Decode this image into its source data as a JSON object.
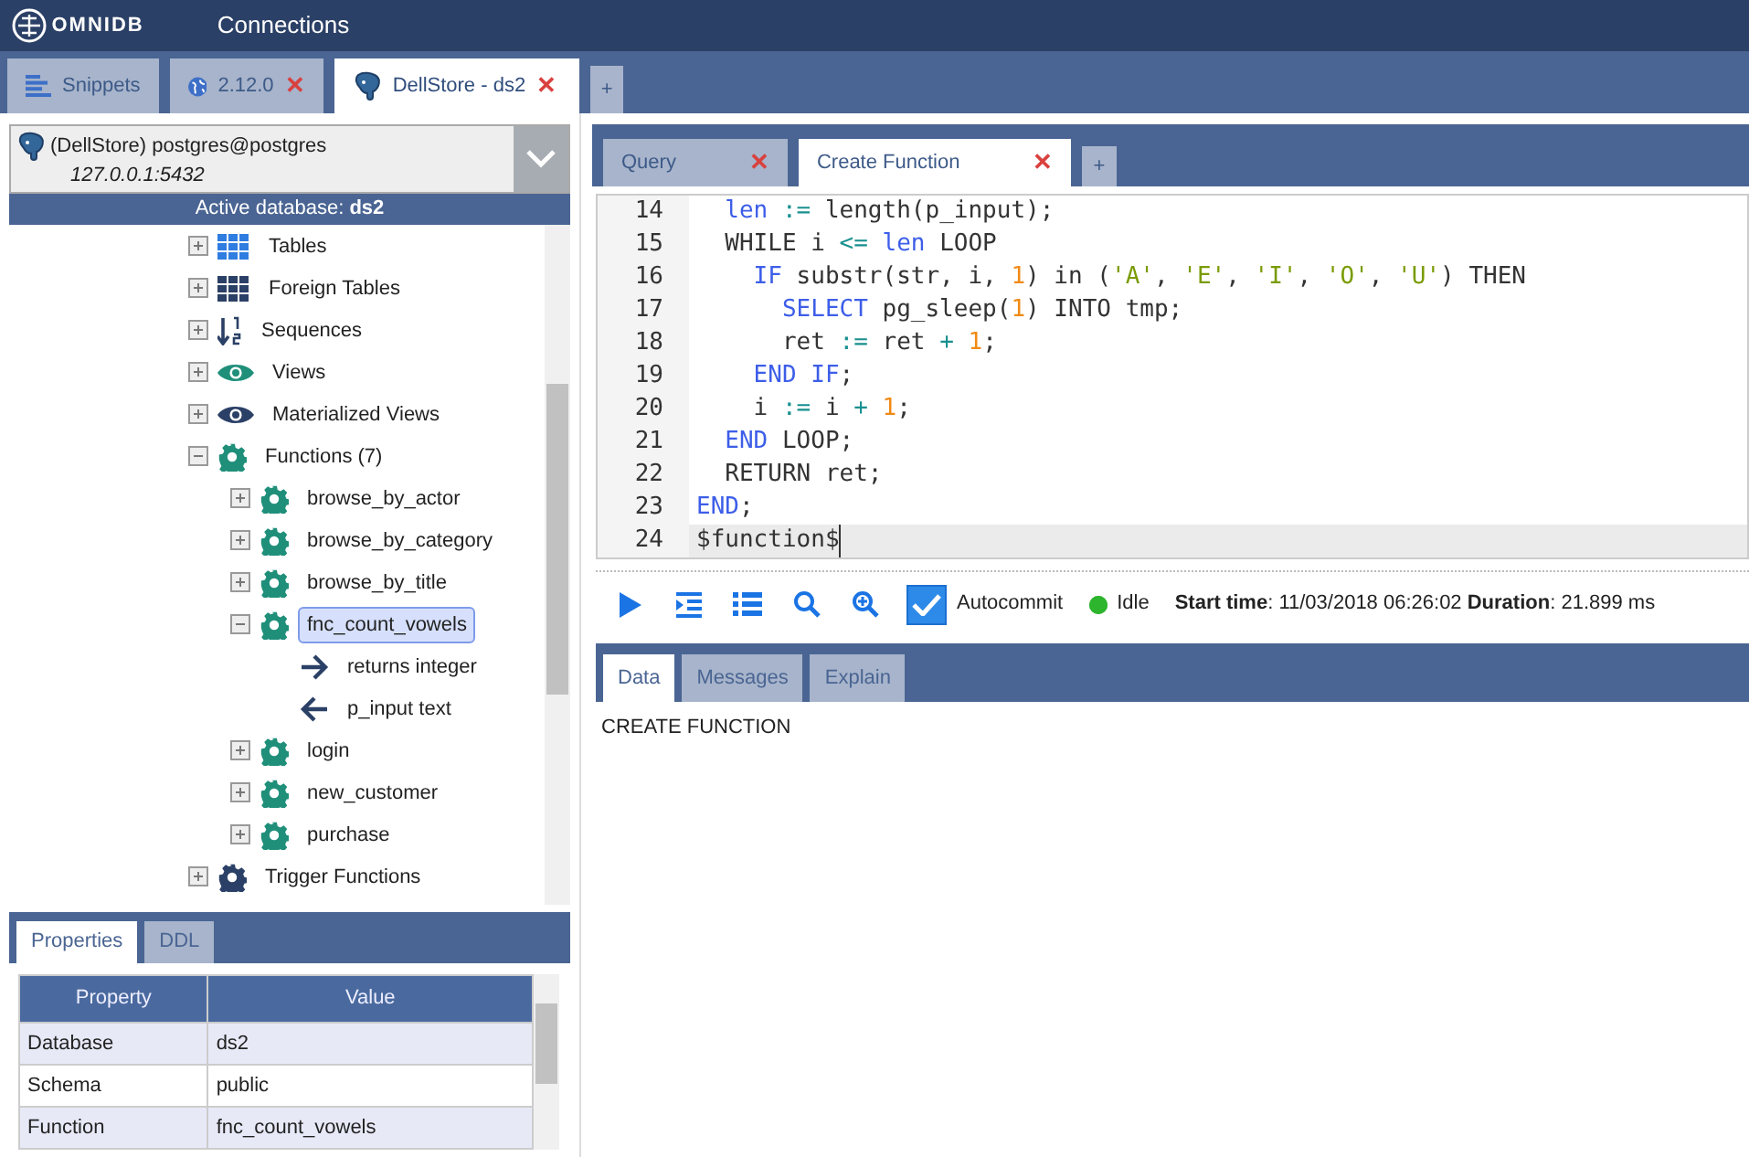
{
  "app": {
    "logo_text": "OMNIDB",
    "menu": "Connections"
  },
  "outer_tabs": [
    {
      "label": "Snippets",
      "kind": "snippets",
      "selected": false
    },
    {
      "label": "2.12.0",
      "kind": "globe",
      "close": "✕",
      "selected": false
    },
    {
      "label": "DellStore - ds2",
      "kind": "postgres",
      "close": "✕",
      "selected": true
    }
  ],
  "add_tab": "+",
  "connection": {
    "name": "(DellStore) postgres@postgres",
    "address": "127.0.0.1:5432",
    "active_database": "Active database: **ds2**"
  },
  "tree": [
    {
      "label": "Tables",
      "kind": "table",
      "expanded": false
    },
    {
      "label": "Foreign Tables",
      "kind": "foreign-table",
      "expanded": false
    },
    {
      "label": "Sequences",
      "kind": "sequence",
      "expanded": false
    },
    {
      "label": "Views",
      "kind": "view",
      "expanded": false
    },
    {
      "label": "Materialized Views",
      "kind": "mview",
      "expanded": false
    },
    {
      "label": "Functions (7)",
      "kind": "function",
      "expanded": true,
      "selected": false,
      "children": [
        {
          "label": "browse_by_actor",
          "kind": "function",
          "expanded": false,
          "selected": false
        },
        {
          "label": "browse_by_category",
          "kind": "function",
          "expanded": false,
          "selected": false
        },
        {
          "label": "browse_by_title",
          "kind": "function",
          "expanded": false,
          "selected": false
        },
        {
          "label": "fnc_count_vowels",
          "kind": "function",
          "expanded": true,
          "selected": true,
          "children": [
            {
              "label": "returns integer",
              "kind": "return",
              "selected": false
            },
            {
              "label": "p_input text",
              "kind": "param",
              "selected": false
            }
          ]
        },
        {
          "label": "login",
          "kind": "function",
          "expanded": false,
          "selected": false
        },
        {
          "label": "new_customer",
          "kind": "function",
          "expanded": false,
          "selected": false
        },
        {
          "label": "purchase",
          "kind": "function",
          "expanded": false,
          "selected": false
        }
      ]
    },
    {
      "label": "Trigger Functions",
      "kind": "trigger-function",
      "expanded": false
    }
  ],
  "property_tabs": [
    {
      "label": "Properties",
      "selected": true
    },
    {
      "label": "DDL",
      "selected": false
    }
  ],
  "properties": {
    "columns": [
      "Property",
      "Value"
    ],
    "rows": [
      [
        "Database",
        "ds2"
      ],
      [
        "Schema",
        "public"
      ],
      [
        "Function",
        "fnc_count_vowels"
      ]
    ]
  },
  "query_tabs": [
    {
      "label": "Query",
      "close": "✕",
      "selected": false
    },
    {
      "label": "Create Function",
      "close": "✕",
      "selected": true
    }
  ],
  "query_add_tab": "+",
  "code": [
    {
      "n": "14",
      "active": false,
      "tokens": [
        {
          "kind": "kw",
          "t": "  len"
        },
        {
          "kind": "op",
          "t": " :="
        },
        {
          "kind": "plain",
          "t": " length(p_input);"
        }
      ]
    },
    {
      "n": "15",
      "active": false,
      "tokens": [
        {
          "kind": "plain",
          "t": "  WHILE i"
        },
        {
          "kind": "op",
          "t": " <="
        },
        {
          "kind": "kw",
          "t": " len"
        },
        {
          "kind": "plain",
          "t": " LOOP"
        }
      ]
    },
    {
      "n": "16",
      "active": false,
      "tokens": [
        {
          "kind": "kw",
          "t": "    IF"
        },
        {
          "kind": "plain",
          "t": " substr(str, i,"
        },
        {
          "kind": "num",
          "t": " 1"
        },
        {
          "kind": "plain",
          "t": ") in ("
        },
        {
          "kind": "str",
          "t": "'A'"
        },
        {
          "kind": "plain",
          "t": ","
        },
        {
          "kind": "str",
          "t": " 'E'"
        },
        {
          "kind": "plain",
          "t": ","
        },
        {
          "kind": "str",
          "t": " 'I'"
        },
        {
          "kind": "plain",
          "t": ","
        },
        {
          "kind": "str",
          "t": " 'O'"
        },
        {
          "kind": "plain",
          "t": ","
        },
        {
          "kind": "str",
          "t": " 'U'"
        },
        {
          "kind": "plain",
          "t": ") THEN"
        }
      ]
    },
    {
      "n": "17",
      "active": false,
      "tokens": [
        {
          "kind": "kw",
          "t": "      SELECT"
        },
        {
          "kind": "plain",
          "t": " pg_sleep("
        },
        {
          "kind": "num",
          "t": "1"
        },
        {
          "kind": "plain",
          "t": ") INTO tmp;"
        }
      ]
    },
    {
      "n": "18",
      "active": false,
      "tokens": [
        {
          "kind": "plain",
          "t": "      ret"
        },
        {
          "kind": "op",
          "t": " :="
        },
        {
          "kind": "plain",
          "t": " ret"
        },
        {
          "kind": "op",
          "t": " +"
        },
        {
          "kind": "num",
          "t": " 1"
        },
        {
          "kind": "plain",
          "t": ";"
        }
      ]
    },
    {
      "n": "19",
      "active": false,
      "tokens": [
        {
          "kind": "kw",
          "t": "    END IF"
        },
        {
          "kind": "plain",
          "t": ";"
        }
      ]
    },
    {
      "n": "20",
      "active": false,
      "tokens": [
        {
          "kind": "plain",
          "t": "    i"
        },
        {
          "kind": "op",
          "t": " :="
        },
        {
          "kind": "plain",
          "t": " i"
        },
        {
          "kind": "op",
          "t": " +"
        },
        {
          "kind": "num",
          "t": " 1"
        },
        {
          "kind": "plain",
          "t": ";"
        }
      ]
    },
    {
      "n": "21",
      "active": false,
      "tokens": [
        {
          "kind": "kw",
          "t": "  END"
        },
        {
          "kind": "plain",
          "t": " LOOP;"
        }
      ]
    },
    {
      "n": "22",
      "active": false,
      "tokens": [
        {
          "kind": "plain",
          "t": "  RETURN ret;"
        }
      ]
    },
    {
      "n": "23",
      "active": false,
      "tokens": [
        {
          "kind": "kw",
          "t": "END"
        },
        {
          "kind": "plain",
          "t": ";"
        }
      ]
    },
    {
      "n": "24",
      "active": true,
      "tokens": [
        {
          "kind": "plain",
          "t": "$function$"
        }
      ]
    }
  ],
  "toolbar": {
    "buttons": [
      {
        "kind": "run"
      },
      {
        "kind": "indent"
      },
      {
        "kind": "list"
      },
      {
        "kind": "search"
      },
      {
        "kind": "zoom-in"
      }
    ],
    "autocommit": {
      "label": "Autocommit",
      "checked": true
    },
    "status": {
      "label": "Idle",
      "color": "#2db52d"
    },
    "timing": "**Start time**: 11/03/2018 06:26:02 **Duration**: 21.899 ms"
  },
  "result_tabs": [
    {
      "label": "Data",
      "selected": true
    },
    {
      "label": "Messages",
      "selected": false
    },
    {
      "label": "Explain",
      "selected": false
    }
  ],
  "result_text": "CREATE FUNCTION"
}
